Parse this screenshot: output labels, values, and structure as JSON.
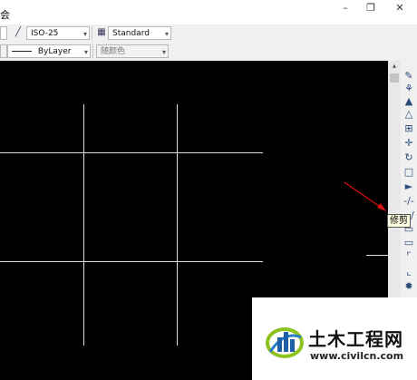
{
  "window": {
    "title_fragment": "会",
    "minimize_label": "–",
    "restore_label": "❐",
    "close_label": "✕"
  },
  "toolbar1": {
    "dimstyle_value": "ISO-25",
    "textstyle_value": "Standard"
  },
  "toolbar2": {
    "linetype_value": "ByLayer",
    "color_value": "随颜色"
  },
  "modify_toolbar": {
    "tools": [
      {
        "name": "erase-icon",
        "glyph": "✎"
      },
      {
        "name": "copy-icon",
        "glyph": "⚘"
      },
      {
        "name": "mirror-icon",
        "glyph": "▲"
      },
      {
        "name": "offset-icon",
        "glyph": "△"
      },
      {
        "name": "array-icon",
        "glyph": "⊞"
      },
      {
        "name": "move-icon",
        "glyph": "✛"
      },
      {
        "name": "rotate-icon",
        "glyph": "↻"
      },
      {
        "name": "scale-icon",
        "glyph": "□"
      },
      {
        "name": "stretch-icon",
        "glyph": "►"
      },
      {
        "name": "trim-icon",
        "glyph": "-/-"
      },
      {
        "name": "extend-icon",
        "glyph": "--/"
      },
      {
        "name": "break-icon",
        "glyph": "▭"
      },
      {
        "name": "join-icon",
        "glyph": "▭"
      },
      {
        "name": "chamfer-icon",
        "glyph": "⌜"
      },
      {
        "name": "fillet-icon",
        "glyph": "⌞"
      },
      {
        "name": "explode-icon",
        "glyph": "✹"
      }
    ],
    "tooltip": "修剪"
  },
  "watermark": {
    "name": "土木工程网",
    "url": "www.civilcn.com"
  },
  "colors": {
    "canvas": "#000000",
    "lines": "#dcdcdc",
    "annotation_arrow": "#e01010",
    "tooltip_bg": "#ffffe1"
  }
}
